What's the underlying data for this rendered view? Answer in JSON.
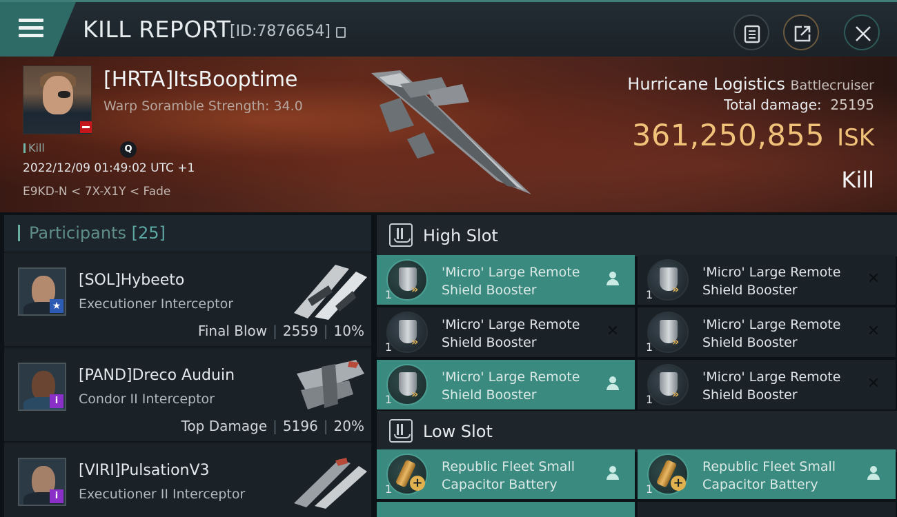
{
  "header": {
    "title": "KILL REPORT",
    "report_id": "[ID:7876654]"
  },
  "victim": {
    "name": "[HRTA]ItsBooptime",
    "warp_scramble": "Warp Soramble Strength: 34.0",
    "kill_tag": "Kill",
    "datetime": "2022/12/09 01:49:02 UTC +1",
    "location": "E9KD-N < 7X-X1Y < Fade",
    "ship_name": "Hurricane Logistics",
    "ship_class": "Battlecruiser",
    "total_damage_label": "Total damage:",
    "total_damage_value": "25195",
    "isk_value": "361,250,855",
    "isk_unit": "ISK",
    "result": "Kill"
  },
  "participants": {
    "label": "Participants",
    "count": "[25]",
    "rows": [
      {
        "name": "[SOL]Hybeeto",
        "ship": "Executioner Interceptor",
        "role": "Final Blow",
        "damage": "2559",
        "percent": "10%",
        "badge": "star"
      },
      {
        "name": "[PAND]Dreco Auduin",
        "ship": "Condor II Interceptor",
        "role": "Top Damage",
        "damage": "5196",
        "percent": "20%",
        "badge": "info"
      },
      {
        "name": "[VIRI]PulsationV3",
        "ship": "Executioner II Interceptor",
        "role": "",
        "damage": "",
        "percent": "",
        "badge": "info"
      }
    ]
  },
  "slots": {
    "high": {
      "title": "High Slot",
      "modules": [
        {
          "name": "'Micro' Large Remote Shield Booster",
          "qty": "1",
          "status": "dropped"
        },
        {
          "name": "'Micro' Large Remote Shield Booster",
          "qty": "1",
          "status": "destroyed"
        },
        {
          "name": "'Micro' Large Remote Shield Booster",
          "qty": "1",
          "status": "destroyed"
        },
        {
          "name": "'Micro' Large Remote Shield Booster",
          "qty": "1",
          "status": "destroyed"
        },
        {
          "name": "'Micro' Large Remote Shield Booster",
          "qty": "1",
          "status": "dropped"
        },
        {
          "name": "'Micro' Large Remote Shield Booster",
          "qty": "1",
          "status": "destroyed"
        }
      ]
    },
    "low": {
      "title": "Low Slot",
      "modules": [
        {
          "name": "Republic Fleet Small Capacitor Battery",
          "qty": "1",
          "status": "dropped"
        },
        {
          "name": "Republic Fleet Small Capacitor Battery",
          "qty": "1",
          "status": "dropped"
        }
      ]
    }
  },
  "icons": {
    "menu": "hamburger-icon",
    "copy": "copy-icon",
    "clipboard": "clipboard-icon",
    "share": "share-icon",
    "close": "close-icon",
    "search": "search-icon",
    "slot": "slot-icon",
    "shield_booster": "shield-booster-icon",
    "capacitor_battery": "capacitor-battery-icon",
    "dropped": "person-icon",
    "destroyed": "x-icon"
  },
  "colors": {
    "accent": "#3b8a7f",
    "isk": "#f0c27a",
    "corp_badge_star": "#2c5bb5",
    "corp_badge_info": "#8b2fc9",
    "minus_badge": "#c4161b"
  }
}
